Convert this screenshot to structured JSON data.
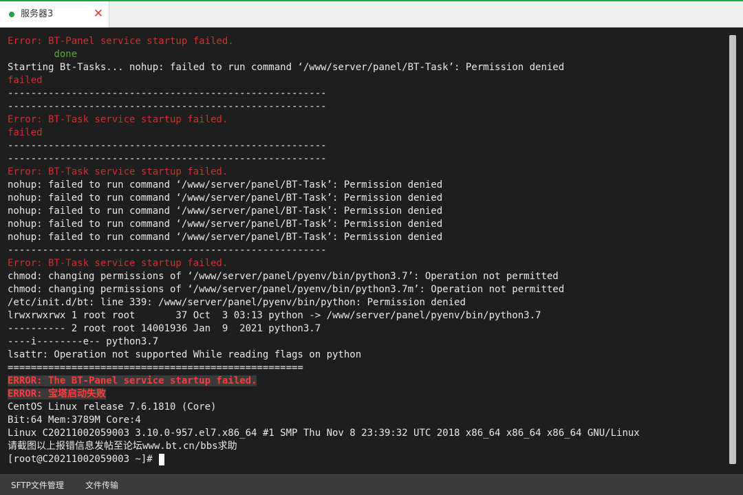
{
  "tab": {
    "label": "服务器3",
    "status_color": "#1aa34a",
    "close_symbol": "✕",
    "close_color": "#e23a3a"
  },
  "terminal": {
    "lines": [
      {
        "text": "Error: BT-Panel service startup failed.",
        "color": "#d12f2f"
      },
      {
        "text": "        done",
        "color": "#5aa83a"
      },
      {
        "text": "Starting Bt-Tasks... nohup: failed to run command ‘/www/server/panel/BT-Task’: Permission denied",
        "color": "#e8e8e8"
      },
      {
        "text": "failed",
        "color": "#d12f2f"
      },
      {
        "text": "-------------------------------------------------------",
        "color": "#e8e8e8"
      },
      {
        "text": "-------------------------------------------------------",
        "color": "#e8e8e8"
      },
      {
        "text": "Error: BT-Task service startup failed.",
        "color": "#d12f2f"
      },
      {
        "text": "failed",
        "color": "#d12f2f"
      },
      {
        "text": "-------------------------------------------------------",
        "color": "#e8e8e8"
      },
      {
        "text": "-------------------------------------------------------",
        "color": "#e8e8e8"
      },
      {
        "text": "Error: BT-Task service startup failed.",
        "color": "#d12f2f"
      },
      {
        "text": "nohup: failed to run command ‘/www/server/panel/BT-Task’: Permission denied",
        "color": "#e8e8e8"
      },
      {
        "text": "nohup: failed to run command ‘/www/server/panel/BT-Task’: Permission denied",
        "color": "#e8e8e8"
      },
      {
        "text": "nohup: failed to run command ‘/www/server/panel/BT-Task’: Permission denied",
        "color": "#e8e8e8"
      },
      {
        "text": "nohup: failed to run command ‘/www/server/panel/BT-Task’: Permission denied",
        "color": "#e8e8e8"
      },
      {
        "text": "nohup: failed to run command ‘/www/server/panel/BT-Task’: Permission denied",
        "color": "#e8e8e8"
      },
      {
        "text": "-------------------------------------------------------",
        "color": "#e8e8e8"
      },
      {
        "text": "Error: BT-Task service startup failed.",
        "color": "#d12f2f"
      },
      {
        "text": "chmod: changing permissions of ‘/www/server/panel/pyenv/bin/python3.7’: Operation not permitted",
        "color": "#e8e8e8"
      },
      {
        "text": "chmod: changing permissions of ‘/www/server/panel/pyenv/bin/python3.7m’: Operation not permitted",
        "color": "#e8e8e8"
      },
      {
        "text": "/etc/init.d/bt: line 339: /www/server/panel/pyenv/bin/python: Permission denied",
        "color": "#e8e8e8"
      },
      {
        "text": "lrwxrwxrwx 1 root root       37 Oct  3 03:13 python -> /www/server/panel/pyenv/bin/python3.7",
        "color": "#e8e8e8"
      },
      {
        "text": "---------- 2 root root 14001936 Jan  9  2021 python3.7",
        "color": "#e8e8e8"
      },
      {
        "text": "----i--------e-- python3.7",
        "color": "#e8e8e8"
      },
      {
        "text": "lsattr: Operation not supported While reading flags on python",
        "color": "#e8e8e8"
      },
      {
        "text": "===================================================",
        "color": "#e8e8e8"
      },
      {
        "text": "ERROR: The BT-Panel service startup failed.",
        "color": "#ff3b3b",
        "bold": true,
        "bg": "#3a3a3a"
      },
      {
        "text": "ERROR: 宝塔启动失败",
        "color": "#ff3b3b",
        "bold": true,
        "bg": "#3a3a3a"
      },
      {
        "text": "CentOS Linux release 7.6.1810 (Core)",
        "color": "#e8e8e8"
      },
      {
        "text": "Bit:64 Mem:3789M Core:4",
        "color": "#e8e8e8"
      },
      {
        "text": "Linux C20211002059003 3.10.0-957.el7.x86_64 #1 SMP Thu Nov 8 23:39:32 UTC 2018 x86_64 x86_64 x86_64 GNU/Linux",
        "color": "#e8e8e8"
      },
      {
        "text": "请截图以上报错信息发帖至论坛www.bt.cn/bbs求助",
        "color": "#e8e8e8"
      }
    ],
    "prompt": "[root@C20211002059003 ~]# "
  },
  "bottom": {
    "sftp_label": "SFTP文件管理",
    "transfer_label": "文件传输"
  }
}
